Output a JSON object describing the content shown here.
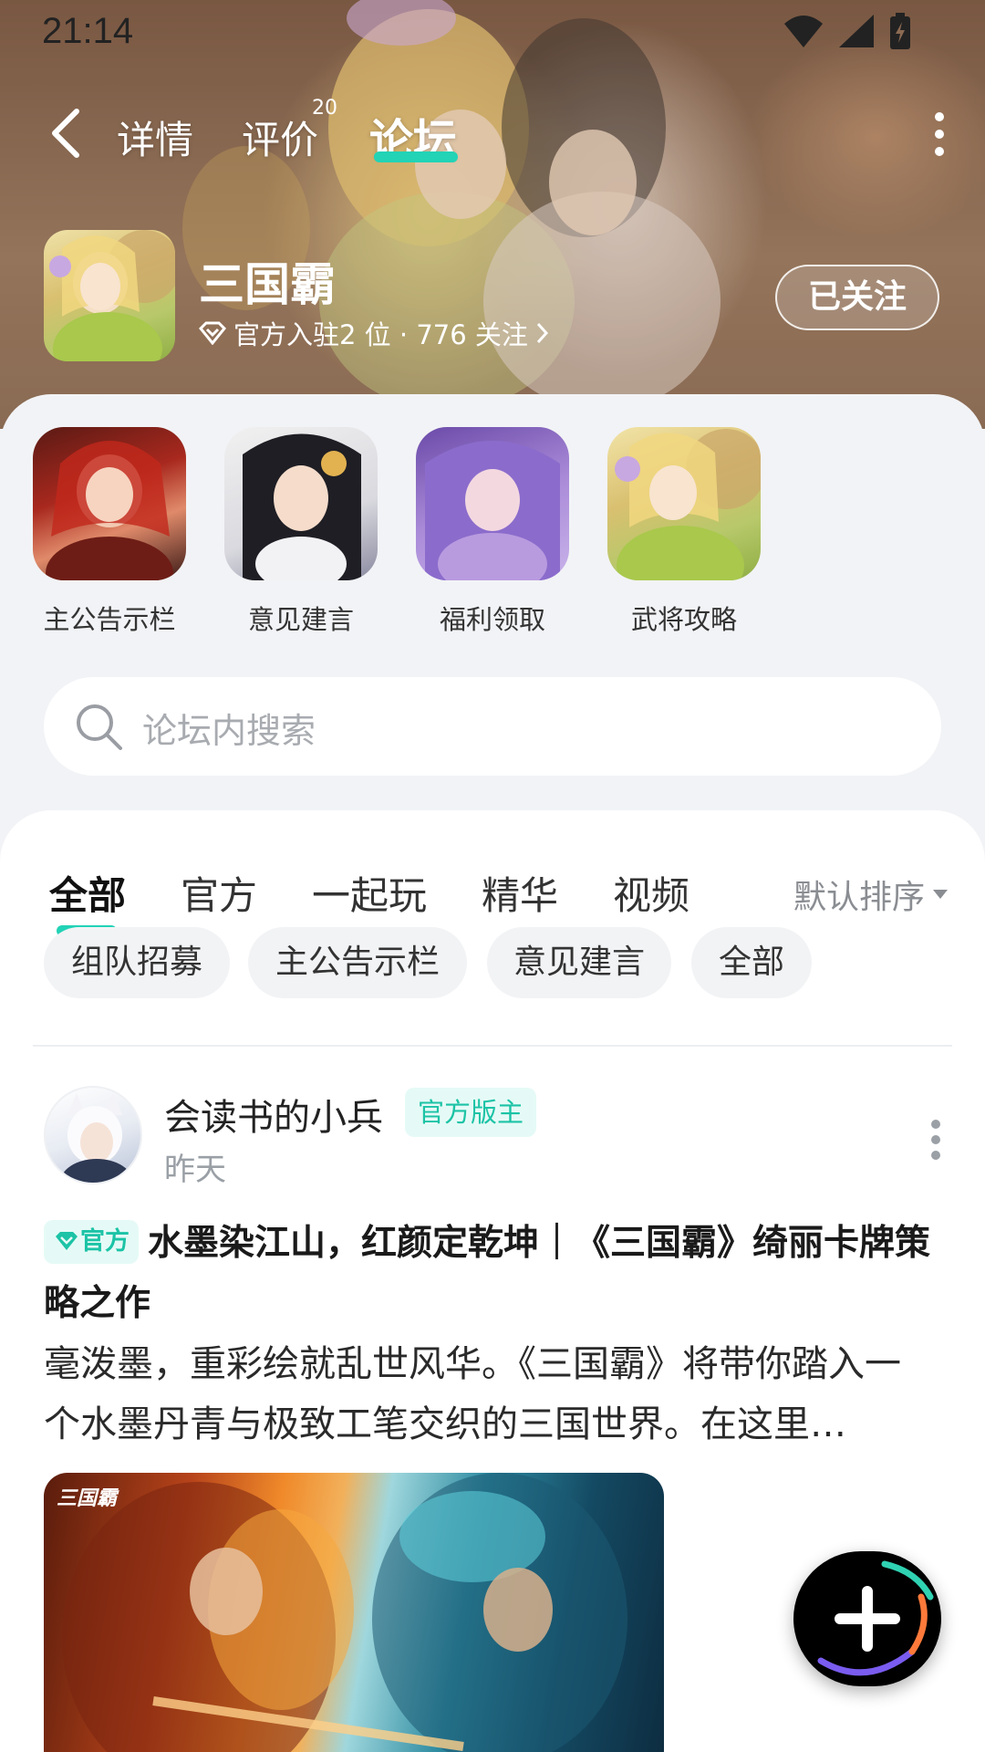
{
  "status_bar": {
    "time": "21:14",
    "icons": [
      "wifi-icon",
      "signal-icon",
      "battery-icon"
    ]
  },
  "top_nav": {
    "tabs": [
      {
        "label": "详情"
      },
      {
        "label": "评价",
        "badge": "20"
      },
      {
        "label": "论坛",
        "active": true
      }
    ],
    "accent_color": "#22d3b6"
  },
  "game": {
    "title": "三国霸",
    "subtitle": "官方入驻2 位 · 776 关注",
    "follow_label": "已关注"
  },
  "boards": [
    {
      "label": "主公告示栏"
    },
    {
      "label": "意见建言"
    },
    {
      "label": "福利领取"
    },
    {
      "label": "武将攻略"
    }
  ],
  "search": {
    "placeholder": "论坛内搜索"
  },
  "feed": {
    "tabs": [
      {
        "label": "全部",
        "active": true
      },
      {
        "label": "官方"
      },
      {
        "label": "一起玩"
      },
      {
        "label": "精华"
      },
      {
        "label": "视频"
      }
    ],
    "sort_label": "默认排序",
    "chips": [
      {
        "label": "组队招募"
      },
      {
        "label": "主公告示栏"
      },
      {
        "label": "意见建言"
      },
      {
        "label": "全部"
      }
    ]
  },
  "post": {
    "author": "会读书的小兵",
    "role": "官方版主",
    "time": "昨天",
    "official_tag": "官方",
    "title": "水墨染江山，红颜定乾坤｜《三国霸》绮丽卡牌策略之作",
    "body": "毫泼墨，重彩绘就乱世风华。《三国霸》将带你踏入一个水墨丹青与极致工笔交织的三国世界。在这里…",
    "image_logo": "三国霸"
  }
}
